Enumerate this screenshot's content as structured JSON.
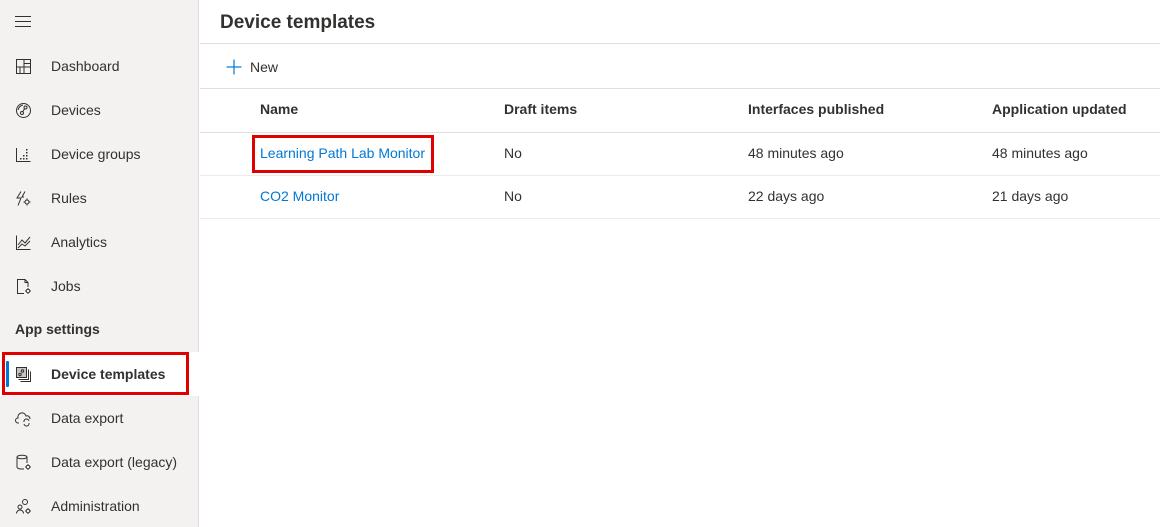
{
  "sidebar": {
    "menu_icon": "hamburger-icon",
    "items": [
      {
        "label": "Dashboard",
        "icon": "dashboard-icon"
      },
      {
        "label": "Devices",
        "icon": "devices-icon"
      },
      {
        "label": "Device groups",
        "icon": "device-groups-icon"
      },
      {
        "label": "Rules",
        "icon": "rules-icon"
      },
      {
        "label": "Analytics",
        "icon": "analytics-icon"
      },
      {
        "label": "Jobs",
        "icon": "jobs-icon"
      }
    ],
    "section_header": "App settings",
    "settings_items": [
      {
        "label": "Device templates",
        "icon": "device-templates-icon",
        "selected": true
      },
      {
        "label": "Data export",
        "icon": "data-export-icon"
      },
      {
        "label": "Data export (legacy)",
        "icon": "data-export-legacy-icon"
      },
      {
        "label": "Administration",
        "icon": "administration-icon"
      }
    ]
  },
  "header": {
    "title": "Device templates"
  },
  "toolbar": {
    "new_label": "New",
    "new_icon": "plus-icon"
  },
  "table": {
    "columns": [
      "Name",
      "Draft items",
      "Interfaces published",
      "Application updated"
    ],
    "rows": [
      {
        "name": "Learning Path Lab Monitor",
        "draft_items": "No",
        "interfaces_published": "48 minutes ago",
        "application_updated": "48 minutes ago"
      },
      {
        "name": "CO2 Monitor",
        "draft_items": "No",
        "interfaces_published": "22 days ago",
        "application_updated": "21 days ago"
      }
    ]
  },
  "colors": {
    "accent": "#0078d4",
    "highlight": "#e00000",
    "sidebar_bg": "#f3f2f1"
  }
}
